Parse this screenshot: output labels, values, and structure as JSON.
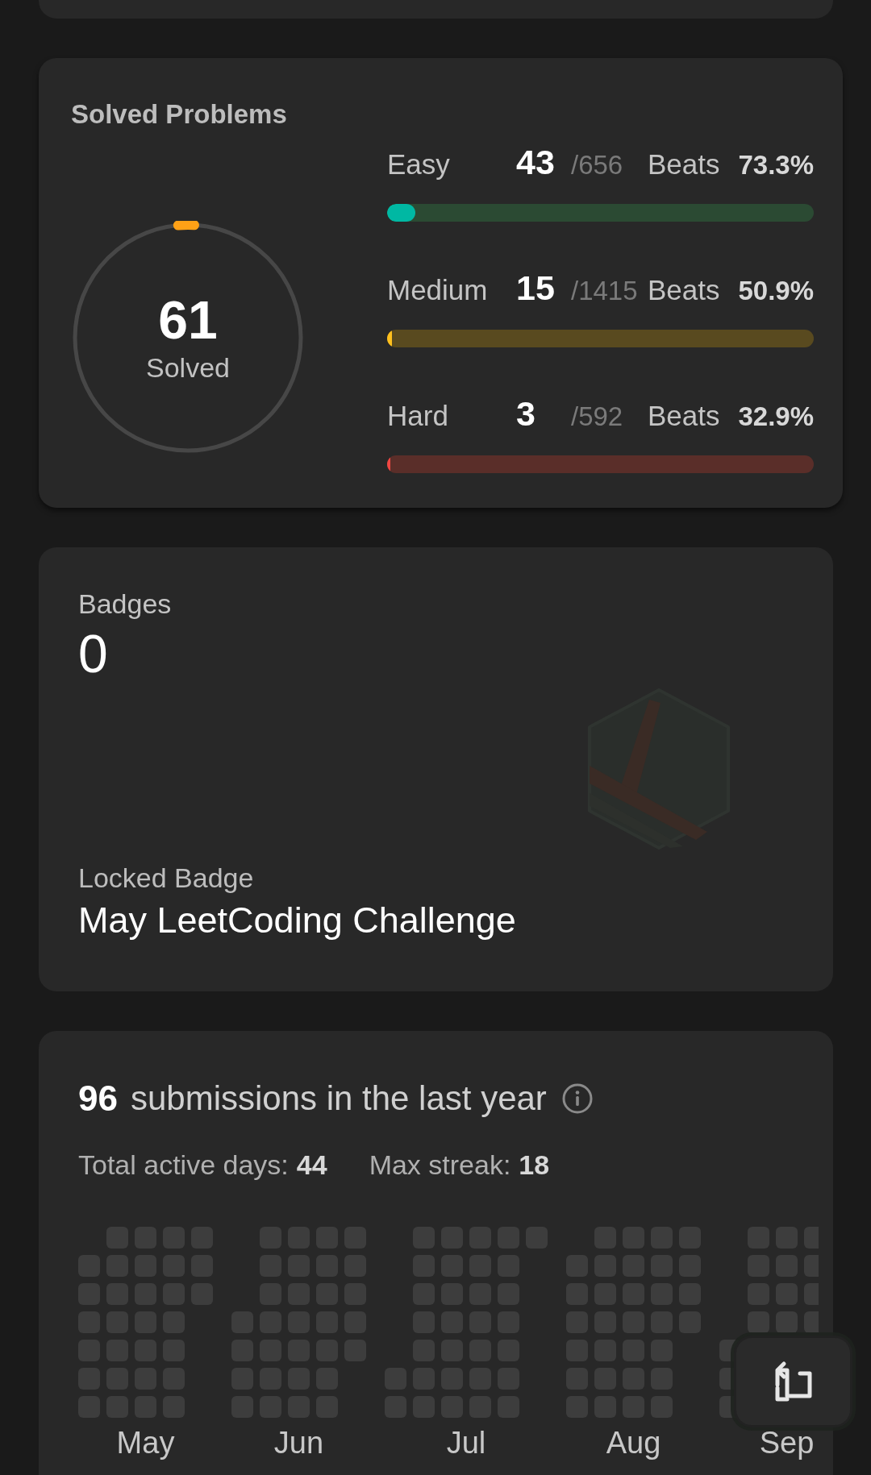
{
  "solved_problems": {
    "title": "Solved Problems",
    "total": "61",
    "total_label": "Solved",
    "level": 0.023,
    "difficulties": [
      {
        "kind": "easy",
        "label": "Easy",
        "solved": "43",
        "total": "/656",
        "beats_label": "Beats",
        "beats": "73.3%",
        "level": 0.066
      },
      {
        "kind": "medium",
        "label": "Medium",
        "solved": "15",
        "total": "/1415",
        "beats_label": "Beats",
        "beats": "50.9%",
        "level": 0.011
      },
      {
        "kind": "hard",
        "label": "Hard",
        "solved": "3",
        "total": "/592",
        "beats_label": "Beats",
        "beats": "32.9%",
        "level": 0.005
      }
    ]
  },
  "badges": {
    "title": "Badges",
    "count": "0",
    "locked_badge": {
      "label": "Locked Badge",
      "name": "May LeetCoding Challenge"
    }
  },
  "submissions": {
    "count": "96",
    "text": "submissions in the last year",
    "stats": [
      {
        "label": "Total active days:",
        "value": "44"
      },
      {
        "label": "Max streak:",
        "value": "18"
      }
    ],
    "months": [
      "May",
      "Jun",
      "Jul",
      "Aug",
      "Sep"
    ]
  }
}
